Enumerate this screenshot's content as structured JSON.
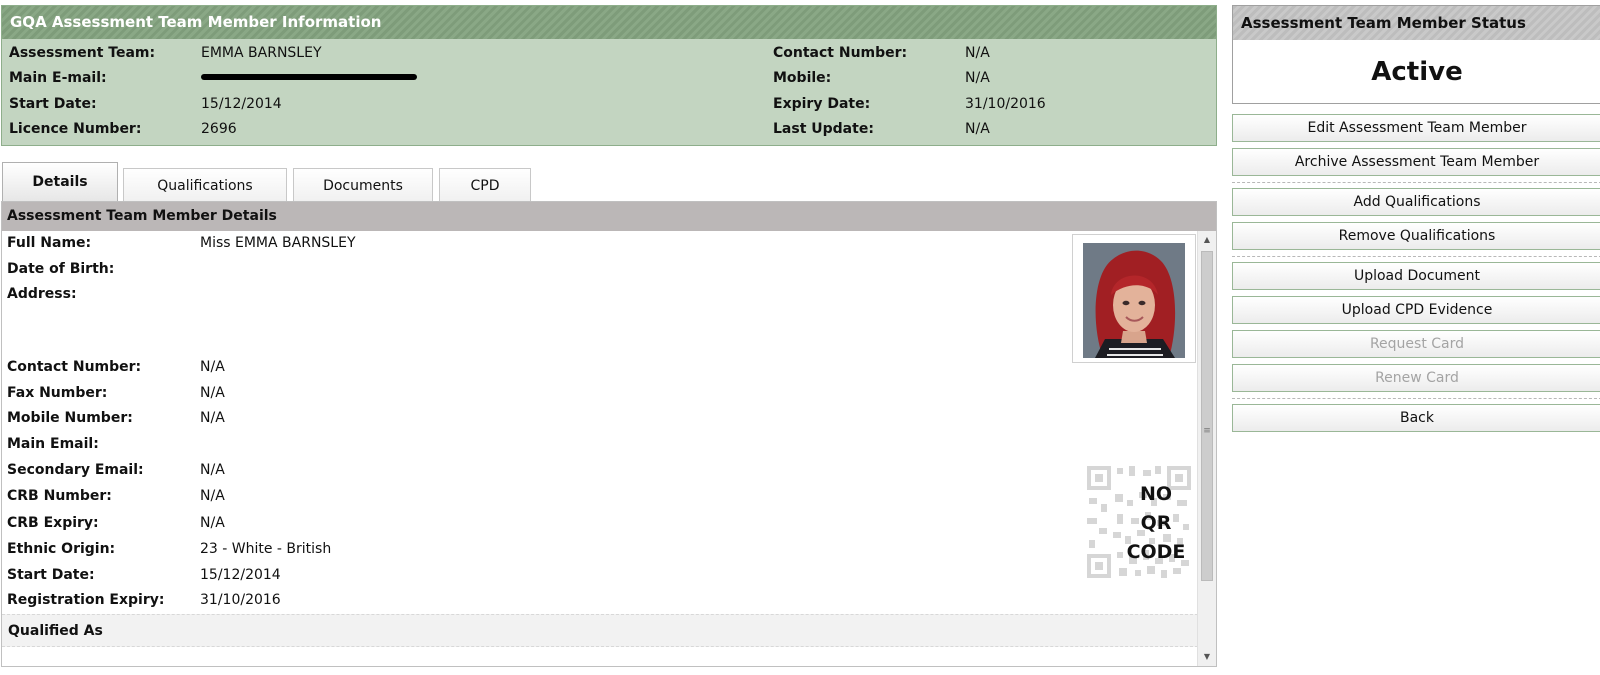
{
  "info": {
    "title": "GQA Assessment Team Member Information",
    "left": [
      {
        "label": "Assessment Team:",
        "value": "EMMA BARNSLEY"
      },
      {
        "label": "Main E-mail:",
        "value": ""
      },
      {
        "label": "Start Date:",
        "value": "15/12/2014"
      },
      {
        "label": "Licence Number:",
        "value": "2696"
      }
    ],
    "right": [
      {
        "label": "Contact Number:",
        "value": "N/A"
      },
      {
        "label": "Mobile:",
        "value": "N/A"
      },
      {
        "label": "Expiry Date:",
        "value": "31/10/2016"
      },
      {
        "label": "Last Update:",
        "value": "N/A"
      }
    ]
  },
  "tabs": [
    {
      "label": "Details",
      "active": true
    },
    {
      "label": "Qualifications",
      "active": false
    },
    {
      "label": "Documents",
      "active": false
    },
    {
      "label": "CPD",
      "active": false
    }
  ],
  "details": {
    "title": "Assessment Team Member Details",
    "rows": [
      {
        "label": "Full Name:",
        "value": "Miss EMMA BARNSLEY"
      },
      {
        "label": "Date of Birth:",
        "value": ""
      },
      {
        "label": "Address:",
        "value": ""
      },
      {
        "label": "Contact Number:",
        "value": "N/A"
      },
      {
        "label": "Fax Number:",
        "value": "N/A"
      },
      {
        "label": "Mobile Number:",
        "value": "N/A"
      },
      {
        "label": "Main Email:",
        "value": ""
      },
      {
        "label": "Secondary Email:",
        "value": "N/A"
      },
      {
        "label": "CRB Number:",
        "value": "N/A"
      },
      {
        "label": "CRB Expiry:",
        "value": "N/A"
      },
      {
        "label": "Ethnic Origin:",
        "value": "23 - White - British"
      },
      {
        "label": "Start Date:",
        "value": "15/12/2014"
      },
      {
        "label": "Registration Expiry:",
        "value": "31/10/2016"
      }
    ],
    "qr_text": [
      "NO",
      "QR",
      "CODE"
    ],
    "qualified_as": "Qualified As"
  },
  "status": {
    "title": "Assessment Team Member Status",
    "value": "Active"
  },
  "actions": [
    {
      "label": "Edit Assessment Team Member",
      "enabled": true
    },
    {
      "label": "Archive Assessment Team Member",
      "enabled": true
    },
    {
      "label": "Add Qualifications",
      "enabled": true
    },
    {
      "label": "Remove Qualifications",
      "enabled": true
    },
    {
      "label": "Upload Document",
      "enabled": true
    },
    {
      "label": "Upload CPD Evidence",
      "enabled": true
    },
    {
      "label": "Request Card",
      "enabled": false
    },
    {
      "label": "Renew Card",
      "enabled": false
    },
    {
      "label": "Back",
      "enabled": true
    }
  ],
  "colors": {
    "info_header": "#849f80",
    "info_background": "#c3d5c1",
    "details_header": "#bbb7b7",
    "button_border": "#9ab797",
    "disabled_text": "#a4a4a4"
  }
}
